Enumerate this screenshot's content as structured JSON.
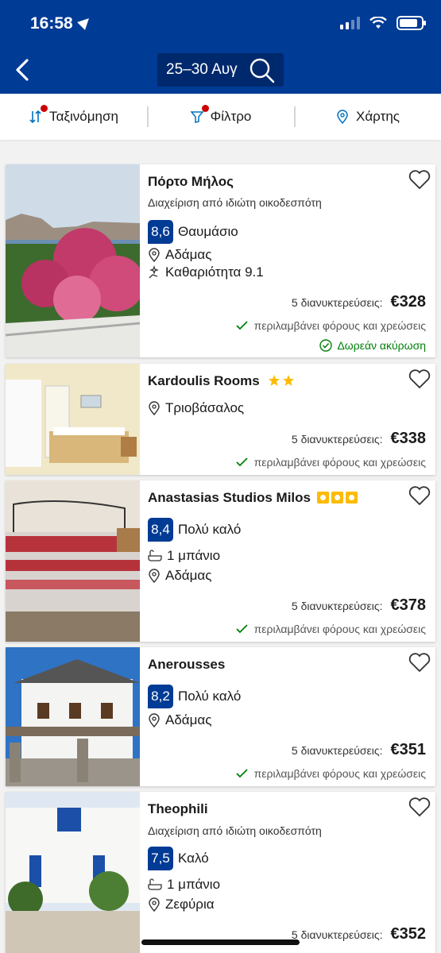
{
  "status": {
    "time": "16:58"
  },
  "header": {
    "dates": "25–30 Αυγ"
  },
  "toolbar": {
    "sort": "Ταξινόμηση",
    "filter": "Φίλτρο",
    "map": "Χάρτης"
  },
  "colors": {
    "brand": "#003b95",
    "green": "#008009",
    "star": "#febb02"
  },
  "hotels": [
    {
      "name": "Πόρτο Μήλος",
      "host": "Διαχείριση από ιδιώτη οικοδεσπότη",
      "score": "8,6",
      "score_label": "Θαυμάσιο",
      "location": "Αδάμας",
      "cleanliness": "Καθαριότητα 9.1",
      "nights": "5 διανυκτερεύσεις:",
      "price": "€328",
      "taxes": "περιλαμβάνει φόρους και χρεώσεις",
      "cancel": "Δωρεάν ακύρωση"
    },
    {
      "name": "Kardoulis Rooms",
      "stars": 2,
      "location": "Τριοβάσαλος",
      "nights": "5 διανυκτερεύσεις:",
      "price": "€338",
      "taxes": "περιλαμβάνει φόρους και χρεώσεις"
    },
    {
      "name": "Anastasias Studios Milos",
      "rating_squares": 3,
      "score": "8,4",
      "score_label": "Πολύ καλό",
      "bath": "1 μπάνιο",
      "location": "Αδάμας",
      "nights": "5 διανυκτερεύσεις:",
      "price": "€378",
      "taxes": "περιλαμβάνει φόρους και χρεώσεις"
    },
    {
      "name": "Anerousses",
      "score": "8,2",
      "score_label": "Πολύ καλό",
      "location": "Αδάμας",
      "nights": "5 διανυκτερεύσεις:",
      "price": "€351",
      "taxes": "περιλαμβάνει φόρους και χρεώσεις"
    },
    {
      "name": "Theophili",
      "host": "Διαχείριση από ιδιώτη οικοδεσπότη",
      "score": "7,5",
      "score_label": "Καλό",
      "bath": "1 μπάνιο",
      "location": "Ζεφύρια",
      "nights": "5 διανυκτερεύσεις:",
      "price": "€352"
    }
  ]
}
